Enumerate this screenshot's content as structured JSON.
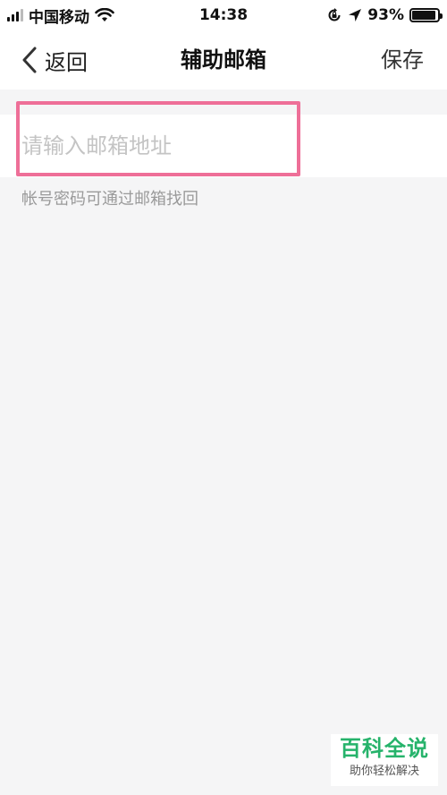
{
  "status_bar": {
    "carrier": "中国移动",
    "time": "14:38",
    "battery": "93%",
    "battery_level": 0.93
  },
  "nav": {
    "back_label": "返回",
    "title": "辅助邮箱",
    "save_label": "保存"
  },
  "form": {
    "email_placeholder": "请输入邮箱地址",
    "email_value": "",
    "hint": "帐号密码可通过邮箱找回"
  },
  "watermark": {
    "main": "百科全说",
    "sub": "助你轻松解决"
  },
  "colors": {
    "highlight": "#ee6f98",
    "watermark_green": "#26b36b"
  },
  "icons": [
    "signal-icon",
    "wifi-icon",
    "orientation-lock-icon",
    "location-arrow-icon",
    "battery-icon",
    "back-chevron-icon"
  ]
}
